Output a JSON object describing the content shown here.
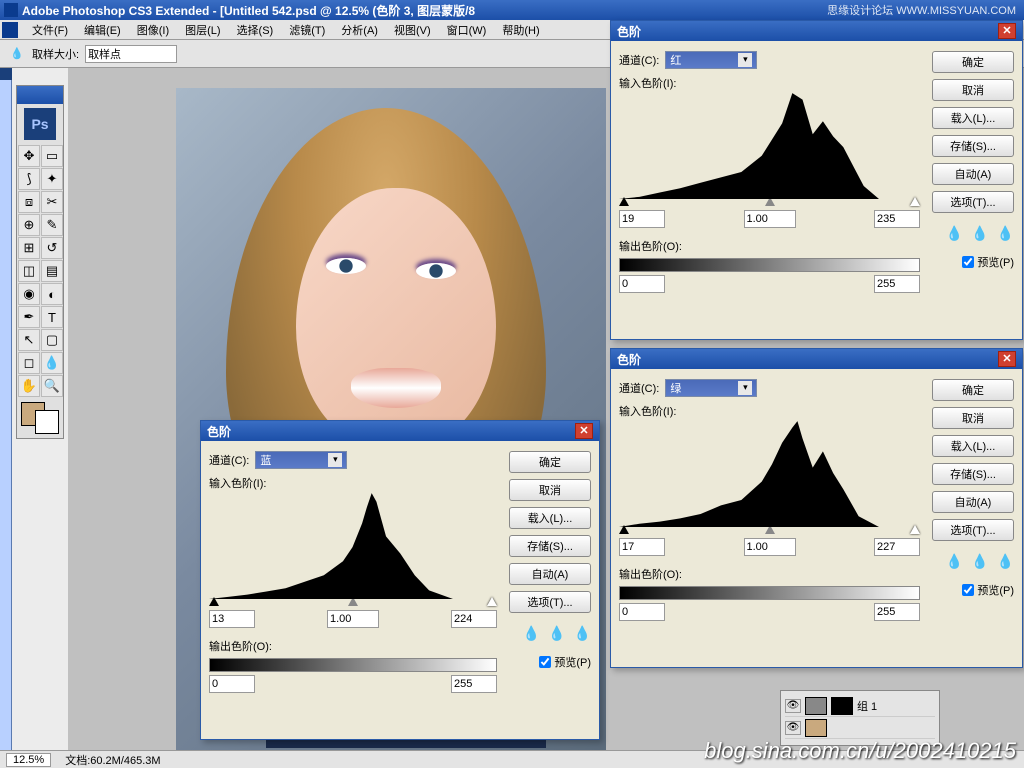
{
  "titlebar": "Adobe Photoshop CS3 Extended - [Untitled 542.psd @ 12.5% (色阶 3, 图层蒙版/8",
  "menu": [
    "文件(F)",
    "编辑(E)",
    "图像(I)",
    "图层(L)",
    "选择(S)",
    "滤镜(T)",
    "分析(A)",
    "视图(V)",
    "窗口(W)",
    "帮助(H)"
  ],
  "options": {
    "sample_label": "取样大小:",
    "sample_value": "取样点"
  },
  "statusbar": {
    "zoom": "12.5%",
    "doc_label": "文档:",
    "doc_value": "60.2M/465.3M"
  },
  "ps_icon": "Ps",
  "dialog_title": "色阶",
  "labels": {
    "channel": "通道(C):",
    "input": "输入色阶(I):",
    "output": "输出色阶(O):",
    "ok": "确定",
    "cancel": "取消",
    "load": "载入(L)...",
    "save": "存储(S)...",
    "auto": "自动(A)",
    "options": "选项(T)...",
    "preview": "预览(P)"
  },
  "dlgBlue": {
    "channel": "蓝",
    "in_lo": "13",
    "in_gamma": "1.00",
    "in_hi": "224",
    "out_lo": "0",
    "out_hi": "255"
  },
  "dlgRed": {
    "channel": "红",
    "in_lo": "19",
    "in_gamma": "1.00",
    "in_hi": "235",
    "out_lo": "0",
    "out_hi": "255"
  },
  "dlgGreen": {
    "channel": "绿",
    "in_lo": "17",
    "in_gamma": "1.00",
    "in_hi": "227",
    "out_lo": "0",
    "out_hi": "255"
  },
  "layers": {
    "group": "组 1"
  },
  "watermark": {
    "top": "思缘设计论坛  WWW.MISSYUAN.COM",
    "bottom": "blog.sina.com.cn/u/2002410215"
  },
  "chart_data": [
    {
      "type": "area",
      "name": "histogram-red",
      "title": "输入色阶 红",
      "xlabel": "",
      "ylabel": "",
      "xlim": [
        0,
        255
      ],
      "x": [
        0,
        20,
        40,
        60,
        80,
        100,
        120,
        140,
        150,
        160,
        170,
        180,
        190,
        200,
        210,
        220,
        230,
        240,
        255
      ],
      "values": [
        0,
        2,
        6,
        10,
        15,
        20,
        25,
        40,
        55,
        70,
        98,
        92,
        60,
        72,
        58,
        48,
        30,
        12,
        0
      ]
    },
    {
      "type": "area",
      "name": "histogram-green",
      "title": "输入色阶 绿",
      "xlabel": "",
      "ylabel": "",
      "xlim": [
        0,
        255
      ],
      "x": [
        0,
        20,
        40,
        60,
        80,
        100,
        120,
        140,
        150,
        160,
        170,
        175,
        180,
        190,
        200,
        210,
        220,
        235,
        255
      ],
      "values": [
        0,
        3,
        5,
        8,
        12,
        20,
        25,
        42,
        58,
        78,
        92,
        98,
        82,
        55,
        70,
        50,
        35,
        10,
        0
      ]
    },
    {
      "type": "area",
      "name": "histogram-blue",
      "title": "输入色阶 蓝",
      "xlabel": "",
      "ylabel": "",
      "xlim": [
        0,
        255
      ],
      "x": [
        0,
        20,
        40,
        60,
        80,
        100,
        120,
        140,
        150,
        160,
        165,
        170,
        175,
        185,
        200,
        215,
        230,
        255
      ],
      "values": [
        0,
        2,
        4,
        7,
        10,
        16,
        22,
        35,
        48,
        70,
        85,
        98,
        90,
        58,
        42,
        22,
        8,
        0
      ]
    }
  ]
}
